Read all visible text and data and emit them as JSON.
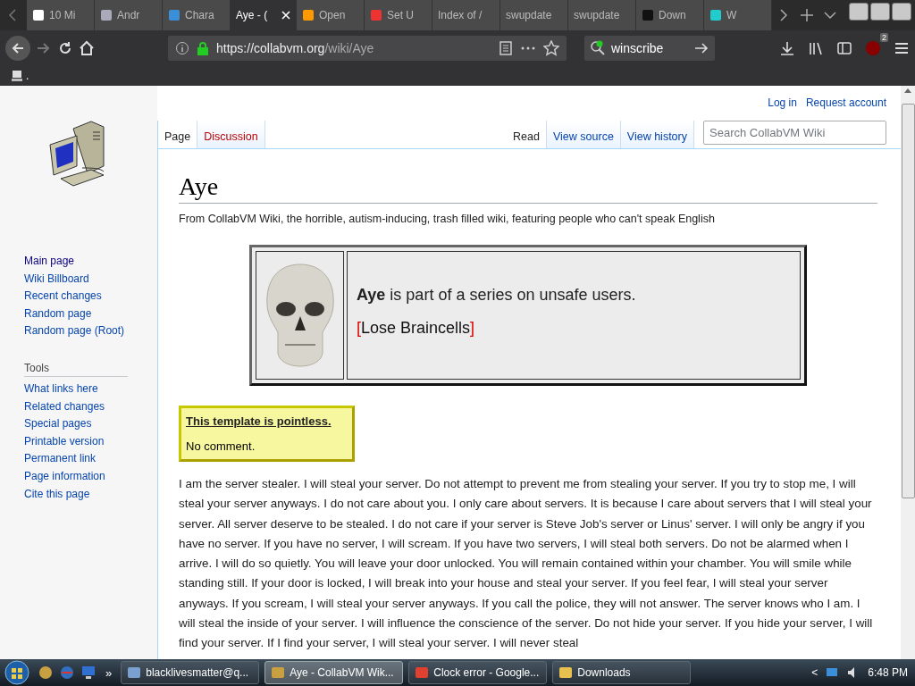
{
  "browser": {
    "tabs": [
      {
        "label": "10 Mi",
        "selected": false
      },
      {
        "label": "Andr",
        "selected": false
      },
      {
        "label": "Chara",
        "selected": false
      },
      {
        "label": "Aye - (",
        "selected": true
      },
      {
        "label": "Open",
        "selected": false
      },
      {
        "label": "Set U",
        "selected": false
      },
      {
        "label": "Index of /",
        "selected": false
      },
      {
        "label": "swupdate",
        "selected": false
      },
      {
        "label": "swupdate",
        "selected": false
      },
      {
        "label": "Down",
        "selected": false
      },
      {
        "label": "W",
        "selected": false
      }
    ],
    "url_host": "https://collabvm.org",
    "url_path": "/wiki/Aye",
    "search_value": "winscribe",
    "addon_badge": "2",
    "bookmark_label": "."
  },
  "wiki": {
    "personal": [
      "Log in",
      "Request account"
    ],
    "navigation": [
      "Main page",
      "Wiki Billboard",
      "Recent changes",
      "Random page",
      "Random page (Root)"
    ],
    "tools_heading": "Tools",
    "tools": [
      "What links here",
      "Related changes",
      "Special pages",
      "Printable version",
      "Permanent link",
      "Page information",
      "Cite this page"
    ],
    "left_tabs": [
      {
        "label": "Page",
        "selected": true,
        "missing": false
      },
      {
        "label": "Discussion",
        "selected": false,
        "missing": true
      }
    ],
    "right_tabs": [
      {
        "label": "Read",
        "selected": true
      },
      {
        "label": "View source",
        "selected": false
      },
      {
        "label": "View history",
        "selected": false
      }
    ],
    "search_placeholder": "Search CollabVM Wiki",
    "title": "Aye",
    "tagline": "From CollabVM Wiki, the horrible, autism-inducing, trash filled wiki, featuring people who can't speak English",
    "infobox": {
      "text": "**Aye** is part of a series on unsafe users.",
      "bracket_open": "[",
      "link": "Lose Braincells",
      "bracket_close": "]"
    },
    "notice": {
      "title": "This template is pointless.",
      "body": "No comment."
    },
    "paragraph": "I am the server stealer. I will steal your server. Do not attempt to prevent me from stealing your server. If you try to stop me, I will steal your server anyways. I do not care about you. I only care about servers. It is because I care about servers that I will steal your server. All server deserve to be stealed. I do not care if your server is Steve Job's server or Linus' server. I will only be angry if you have no server. If you have no server, I will scream. If you have two servers, I will steal both servers. Do not be alarmed when I arrive. I will do so quietly. You will leave your door unlocked. You will remain contained within your chamber. You will smile while standing still. If your door is locked, I will break into your house and steal your server. If you feel fear, I will steal your server anyways. If you scream, I will steal your server anyways. If you call the police, they will not answer. The server knows who I am. I will steal the inside of your server. I will influence the conscience of the server. Do not hide your server. If you hide your server, I will find your server. If I find your server, I will steal your server. I will never steal"
  },
  "taskbar": {
    "more": "»",
    "tasks": [
      {
        "label": "blacklivesmatter@q...",
        "selected": false
      },
      {
        "label": "Aye - CollabVM Wik...",
        "selected": true
      },
      {
        "label": "Clock error - Google...",
        "selected": false
      },
      {
        "label": "Downloads",
        "selected": false
      }
    ],
    "tray_arrow": "<",
    "time": "6:48 PM"
  }
}
